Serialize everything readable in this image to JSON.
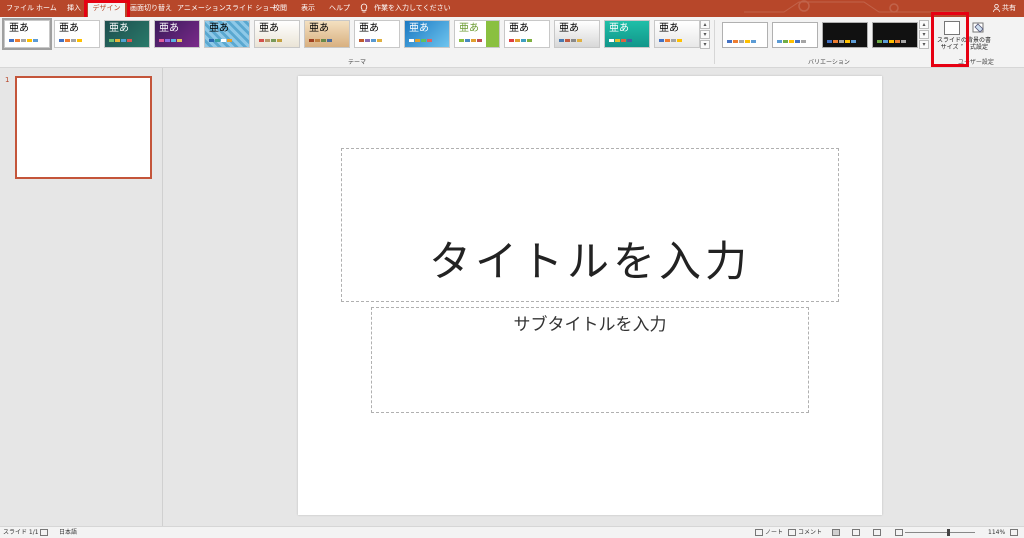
{
  "tabs": [
    "ファイル",
    "ホーム",
    "挿入",
    "デザイン",
    "画面切り替え",
    "アニメーション",
    "スライド ショー",
    "校閲",
    "表示",
    "ヘルプ"
  ],
  "tell_me": "作業を入力してください",
  "share_label": "共有",
  "theme_glyph": "亜あ",
  "groups": {
    "themes_label": "テーマ",
    "variants_label": "バリエーション",
    "customize_label": "ユーザー設定"
  },
  "buttons": {
    "slide_size_line1": "スライドの",
    "slide_size_line2": "サイズ ˅",
    "format_bg_line1": "背景の書",
    "format_bg_line2": "式設定"
  },
  "slide": {
    "number": "1",
    "title_placeholder": "タイトルを入力",
    "subtitle_placeholder": "サブタイトルを入力"
  },
  "status": {
    "slide_count": "スライド 1/1",
    "language": "日本語",
    "notes": "ノート",
    "comments": "コメント",
    "zoom": "114%"
  },
  "colors": {
    "accent": "#b7472a",
    "highlight": "#e60012"
  }
}
